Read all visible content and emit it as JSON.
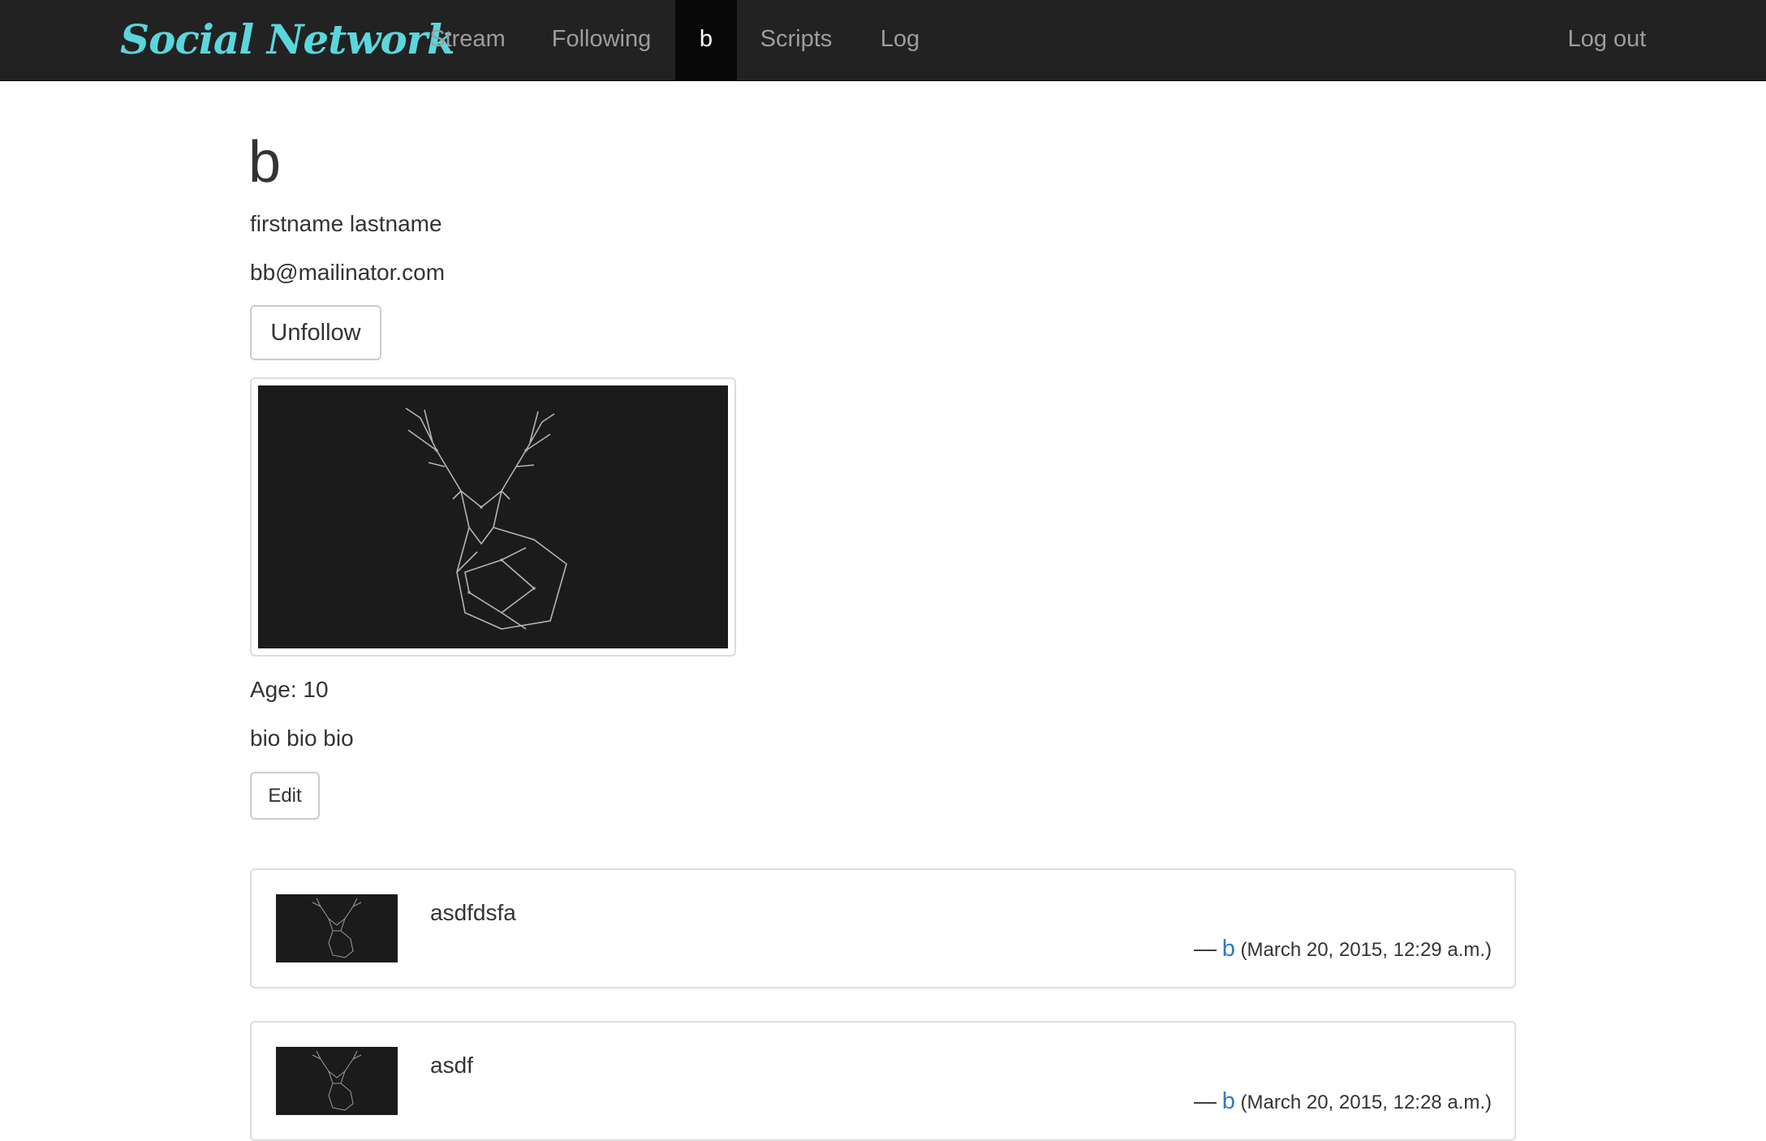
{
  "app": {
    "brand": "Social Network",
    "accent_color": "#5ad6dd",
    "navbar_bg": "#222222"
  },
  "nav": {
    "stream": "Stream",
    "following": "Following",
    "current_user": "b",
    "scripts": "Scripts",
    "log": "Log",
    "logout": "Log out"
  },
  "profile": {
    "username": "b",
    "full_name": "firstname lastname",
    "email": "bb@mailinator.com",
    "unfollow_label": "Unfollow",
    "image": "deer-antlers-image",
    "age": "Age: 10",
    "bio": "bio bio bio",
    "edit_label": "Edit"
  },
  "posts": [
    {
      "text": "asdfdsfa",
      "dash": "—",
      "author": "b",
      "timestamp": "(March 20, 2015, 12:29 a.m.)",
      "thumbnail": "deer-antlers-image"
    },
    {
      "text": "asdf",
      "dash": "—",
      "author": "b",
      "timestamp": "(March 20, 2015, 12:28 a.m.)",
      "thumbnail": "deer-antlers-image"
    }
  ]
}
